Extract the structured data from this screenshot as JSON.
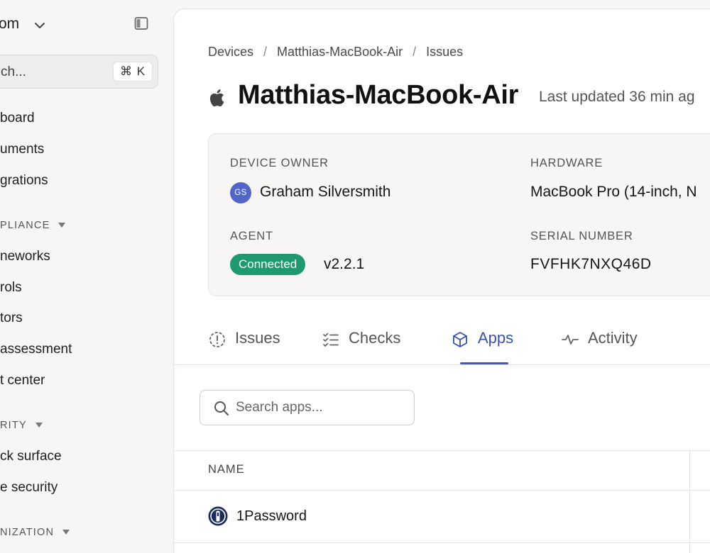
{
  "sidebar": {
    "org_name": "om",
    "search": {
      "text": "ch...",
      "shortcut": "⌘ K"
    },
    "items_top": [
      {
        "label": "board"
      },
      {
        "label": "uments"
      },
      {
        "label": "grations"
      }
    ],
    "sections": [
      {
        "title": "PLIANCE",
        "items": [
          {
            "label": "neworks"
          },
          {
            "label": "rols"
          },
          {
            "label": "tors"
          },
          {
            "label": "assessment"
          },
          {
            "label": "t center"
          }
        ]
      },
      {
        "title": "RITY",
        "items": [
          {
            "label": "ck surface"
          },
          {
            "label": "e security"
          }
        ]
      },
      {
        "title": "NIZATION",
        "items": []
      }
    ]
  },
  "main": {
    "breadcrumb": [
      "Devices",
      "Matthias-MacBook-Air",
      "Issues"
    ],
    "breadcrumb_separator": "/",
    "title": "Matthias-MacBook-Air",
    "last_updated": "Last updated 36 min ag",
    "device": {
      "owner_label": "DEVICE OWNER",
      "owner_initials": "GS",
      "owner_name": "Graham Silversmith",
      "hardware_label": "HARDWARE",
      "hardware_value": "MacBook Pro (14-inch, N",
      "agent_label": "AGENT",
      "agent_status": "Connected",
      "agent_version": "v2.2.1",
      "serial_label": "SERIAL NUMBER",
      "serial_value": "FVFHK7NXQ46D"
    },
    "tabs": [
      {
        "label": "Issues",
        "icon": "alert-circle-icon",
        "active": false
      },
      {
        "label": "Checks",
        "icon": "checklist-icon",
        "active": false
      },
      {
        "label": "Apps",
        "icon": "box-icon",
        "active": true
      },
      {
        "label": "Activity",
        "icon": "activity-icon",
        "active": false
      }
    ],
    "apps_search": {
      "placeholder": "Search apps..."
    },
    "table": {
      "columns": [
        "NAME"
      ],
      "rows": [
        {
          "name": "1Password",
          "icon": "1password-icon"
        }
      ]
    }
  },
  "colors": {
    "accent": "#4257c4",
    "status_connected": "#1f9a6f",
    "avatar": "#5266c9"
  }
}
